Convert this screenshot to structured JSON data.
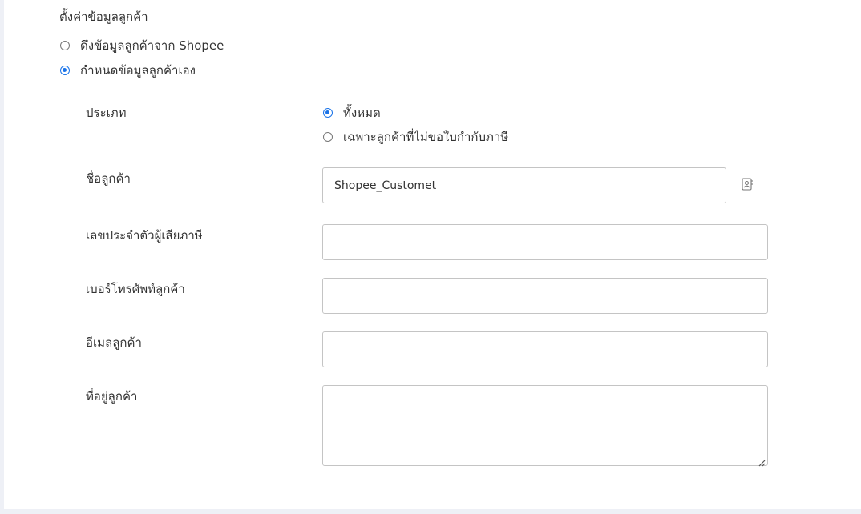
{
  "customer_settings": {
    "title": "ตั้งค่าข้อมูลลูกค้า",
    "source_options": [
      {
        "label": "ดึงข้อมูลลูกค้าจาก Shopee",
        "checked": false
      },
      {
        "label": "กำหนดข้อมูลลูกค้าเอง",
        "checked": true
      }
    ]
  },
  "form": {
    "type_label": "ประเภท",
    "type_options": [
      {
        "label": "ทั้งหมด",
        "checked": true
      },
      {
        "label": "เฉพาะลูกค้าที่ไม่ขอใบกำกับภาษี",
        "checked": false
      }
    ],
    "customer_name_label": "ชื่อลูกค้า",
    "customer_name_value": "Shopee_Customet",
    "tax_id_label": "เลขประจำตัวผู้เสียภาษี",
    "tax_id_value": "",
    "phone_label": "เบอร์โทรศัพท์ลูกค้า",
    "phone_value": "",
    "email_label": "อีเมลลูกค้า",
    "email_value": "",
    "address_label": "ที่อยู่ลูกค้า",
    "address_value": ""
  },
  "colors": {
    "accent": "#1a73e8",
    "border": "#c4c4c4",
    "background": "#eef0f6"
  },
  "icons": {
    "contact_book": "contact-book-icon",
    "resize_grip": "resize-grip-icon"
  }
}
